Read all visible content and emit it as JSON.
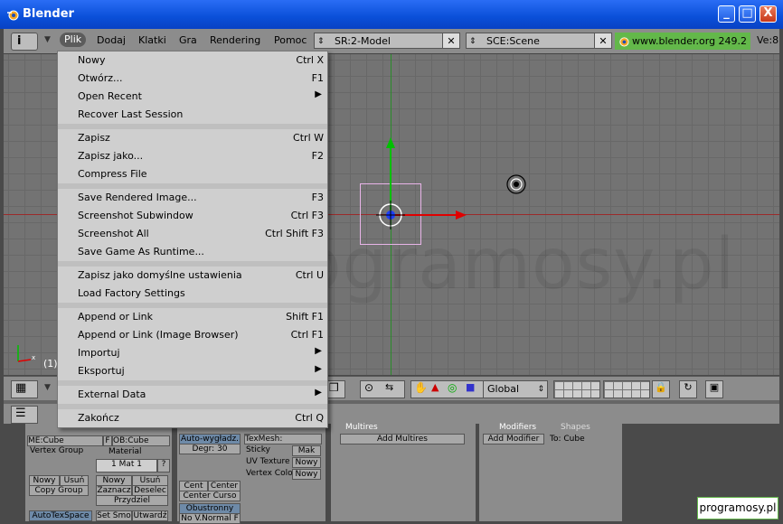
{
  "window": {
    "title": "Blender",
    "min_label": "_",
    "max_label": "□",
    "close_label": "X"
  },
  "menubar": {
    "items": [
      "Plik",
      "Dodaj",
      "Klatki",
      "Gra",
      "Rendering",
      "Pomoc"
    ],
    "screen_field": "SR:2-Model",
    "scene_field": "SCE:Scene",
    "info": "www.blender.org 249.2",
    "ve": "Ve:8"
  },
  "viewport": {
    "frame_label": "(1)",
    "watermark": "programosy.pl"
  },
  "toolbar": {
    "orientation": "Global"
  },
  "file_menu": {
    "groups": [
      [
        {
          "label": "Nowy",
          "shortcut": "Ctrl X"
        },
        {
          "label": "Otwórz...",
          "shortcut": "F1"
        },
        {
          "label": "Open Recent",
          "submenu": "▶"
        },
        {
          "label": "Recover Last Session"
        }
      ],
      [
        {
          "label": "Zapisz",
          "shortcut": "Ctrl W"
        },
        {
          "label": "Zapisz jako...",
          "shortcut": "F2"
        },
        {
          "label": "Compress File"
        }
      ],
      [
        {
          "label": "Save Rendered Image...",
          "shortcut": "F3"
        },
        {
          "label": "Screenshot Subwindow",
          "shortcut": "Ctrl F3"
        },
        {
          "label": "Screenshot All",
          "shortcut": "Ctrl Shift F3"
        },
        {
          "label": "Save Game As Runtime..."
        }
      ],
      [
        {
          "label": "Zapisz jako domyślne ustawienia",
          "shortcut": "Ctrl U"
        },
        {
          "label": "Load Factory Settings"
        }
      ],
      [
        {
          "label": "Append or Link",
          "shortcut": "Shift F1"
        },
        {
          "label": "Append or Link (Image Browser)",
          "shortcut": "Ctrl F1"
        },
        {
          "label": "Importuj",
          "submenu": "▶"
        },
        {
          "label": "Eksportuj",
          "submenu": "▶"
        }
      ],
      [
        {
          "label": "External Data",
          "submenu": "▶"
        }
      ],
      [
        {
          "label": "Zakończ",
          "shortcut": "Ctrl Q"
        }
      ]
    ]
  },
  "panels": {
    "link": {
      "me": "ME:Cube",
      "f": "F",
      "ob": "OB:Cube",
      "vg": "Vertex Group",
      "mat": "Material",
      "mat_count": "1 Mat 1",
      "q": "?",
      "nowy": "Nowy",
      "usun": "Usuń",
      "copy_group": "Copy Group",
      "nowy2": "Nowy",
      "usun2": "Usuń",
      "zaznacz": "Zaznacz",
      "deselec": "Deselec",
      "przydziel": "Przydziel",
      "autotex": "AutoTexSpace",
      "setsmo": "Set Smo",
      "utwardz": "Utwardź"
    },
    "mesh": {
      "auto": "Auto-wygładz.",
      "degr": "Degr: 30",
      "cent": "Cent",
      "center": "Center",
      "center_cursor": "Center Curso",
      "obustronny": "Obustronny",
      "novnormal": "No V.Normal F",
      "texmesh": "TexMesh:",
      "sticky": "Sticky",
      "mak": "Mak",
      "uvtex": "UV Texture",
      "nowy": "Nowy",
      "vcol": "Vertex Colo",
      "nowy2": "Nowy"
    },
    "multires": {
      "tab": "Multires",
      "add": "Add Multires"
    },
    "modifiers": {
      "tab1": "Modifiers",
      "tab2": "Shapes",
      "add": "Add Modifier",
      "to": "To: Cube"
    }
  },
  "badge": "programosy.pl"
}
